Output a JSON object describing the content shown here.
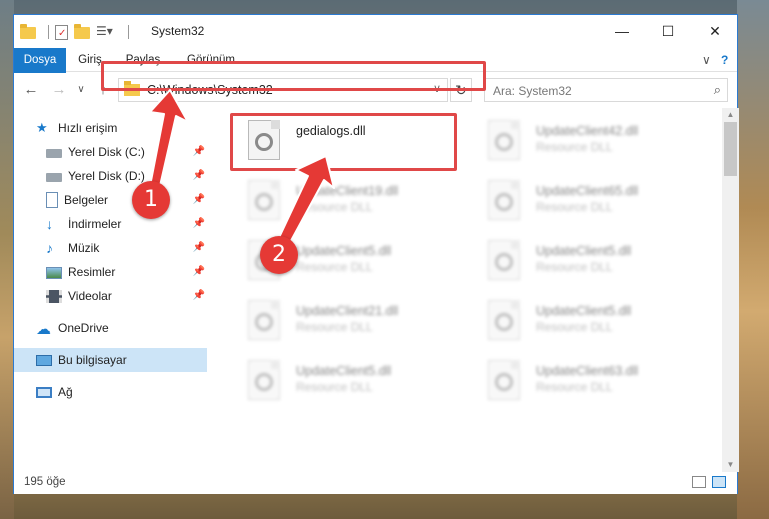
{
  "window": {
    "title": "System32"
  },
  "ribbon": {
    "tabs": [
      "Dosya",
      "Giriş",
      "Paylaş",
      "Görünüm"
    ]
  },
  "address": {
    "path": "C:\\Windows\\System32"
  },
  "search": {
    "placeholder": "Ara: System32"
  },
  "nav": {
    "items": [
      {
        "label": "Hızlı erişim",
        "icon": "star-icon"
      },
      {
        "label": "Yerel Disk (C:)",
        "icon": "drive-icon"
      },
      {
        "label": "Yerel Disk (D:)",
        "icon": "drive-icon"
      },
      {
        "label": "Belgeler",
        "icon": "document-icon"
      },
      {
        "label": "İndirmeler",
        "icon": "download-icon"
      },
      {
        "label": "Müzik",
        "icon": "music-icon"
      },
      {
        "label": "Resimler",
        "icon": "pictures-icon"
      },
      {
        "label": "Videolar",
        "icon": "video-icon"
      },
      {
        "label": "OneDrive",
        "icon": "cloud-icon"
      },
      {
        "label": "Bu bilgisayar",
        "icon": "computer-icon"
      },
      {
        "label": "Ağ",
        "icon": "network-icon"
      }
    ]
  },
  "files": [
    {
      "name": "gedialogs.dll",
      "desc": ""
    },
    {
      "name": "UpdateClient42.dll",
      "desc": "Resource DLL"
    },
    {
      "name": "UpdateClient19.dll",
      "desc": "Resource DLL"
    },
    {
      "name": "UpdateClient65.dll",
      "desc": "Resource DLL"
    },
    {
      "name": "UpdateClient5.dll",
      "desc": "Resource DLL"
    },
    {
      "name": "UpdateClient5.dll",
      "desc": "Resource DLL"
    },
    {
      "name": "UpdateClient21.dll",
      "desc": "Resource DLL"
    },
    {
      "name": "UpdateClient5.dll",
      "desc": "Resource DLL"
    },
    {
      "name": "UpdateClient5.dll",
      "desc": "Resource DLL"
    },
    {
      "name": "UpdateClient63.dll",
      "desc": "Resource DLL"
    }
  ],
  "status": {
    "count": "195 öğe"
  },
  "annotations": {
    "step1": "1",
    "step2": "2"
  },
  "colors": {
    "accent": "#1979ca",
    "highlight": "#e04848",
    "badge": "#e53935"
  }
}
